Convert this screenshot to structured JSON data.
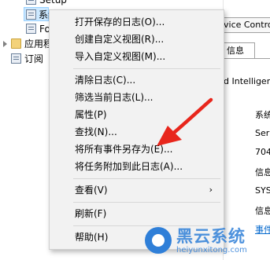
{
  "tree": {
    "items": [
      {
        "label": "Setup",
        "icon": "log-icon"
      },
      {
        "label": "系统",
        "icon": "log-icon"
      },
      {
        "label": "Fo",
        "icon": "log-icon"
      },
      {
        "label": "应用程",
        "icon": "folder-icon"
      },
      {
        "label": "订阅",
        "icon": "subscription-icon"
      }
    ]
  },
  "right_pane": {
    "header": "vice Contro",
    "tab": "信息",
    "title": "d Intelligen",
    "rows": [
      "系统",
      "Ser",
      "704",
      "信息",
      "SYS",
      "信息",
      "事件"
    ]
  },
  "menu": {
    "items": [
      {
        "label": "打开保存的日志(O)..."
      },
      {
        "label": "创建自定义视图(R)..."
      },
      {
        "label": "导入自定义视图(M)..."
      },
      {
        "label": "清除日志(C)..."
      },
      {
        "label": "筛选当前日志(L)..."
      },
      {
        "label": "属性(P)"
      },
      {
        "label": "查找(N)..."
      },
      {
        "label": "将所有事件另存为(E)..."
      },
      {
        "label": "将任务附加到此日志(A)..."
      },
      {
        "label": "查看(V)"
      },
      {
        "label": "刷新(F)"
      },
      {
        "label": "帮助(H)"
      }
    ],
    "submenu_arrow": "›"
  },
  "watermark": {
    "main": "黑云系统",
    "sub": "heiyunxitong.com"
  },
  "colors": {
    "menu_bg": "#f2f2f2",
    "selection": "#cce8ff",
    "annotation_arrow": "#e8261c",
    "watermark": "#2f7fd8"
  }
}
